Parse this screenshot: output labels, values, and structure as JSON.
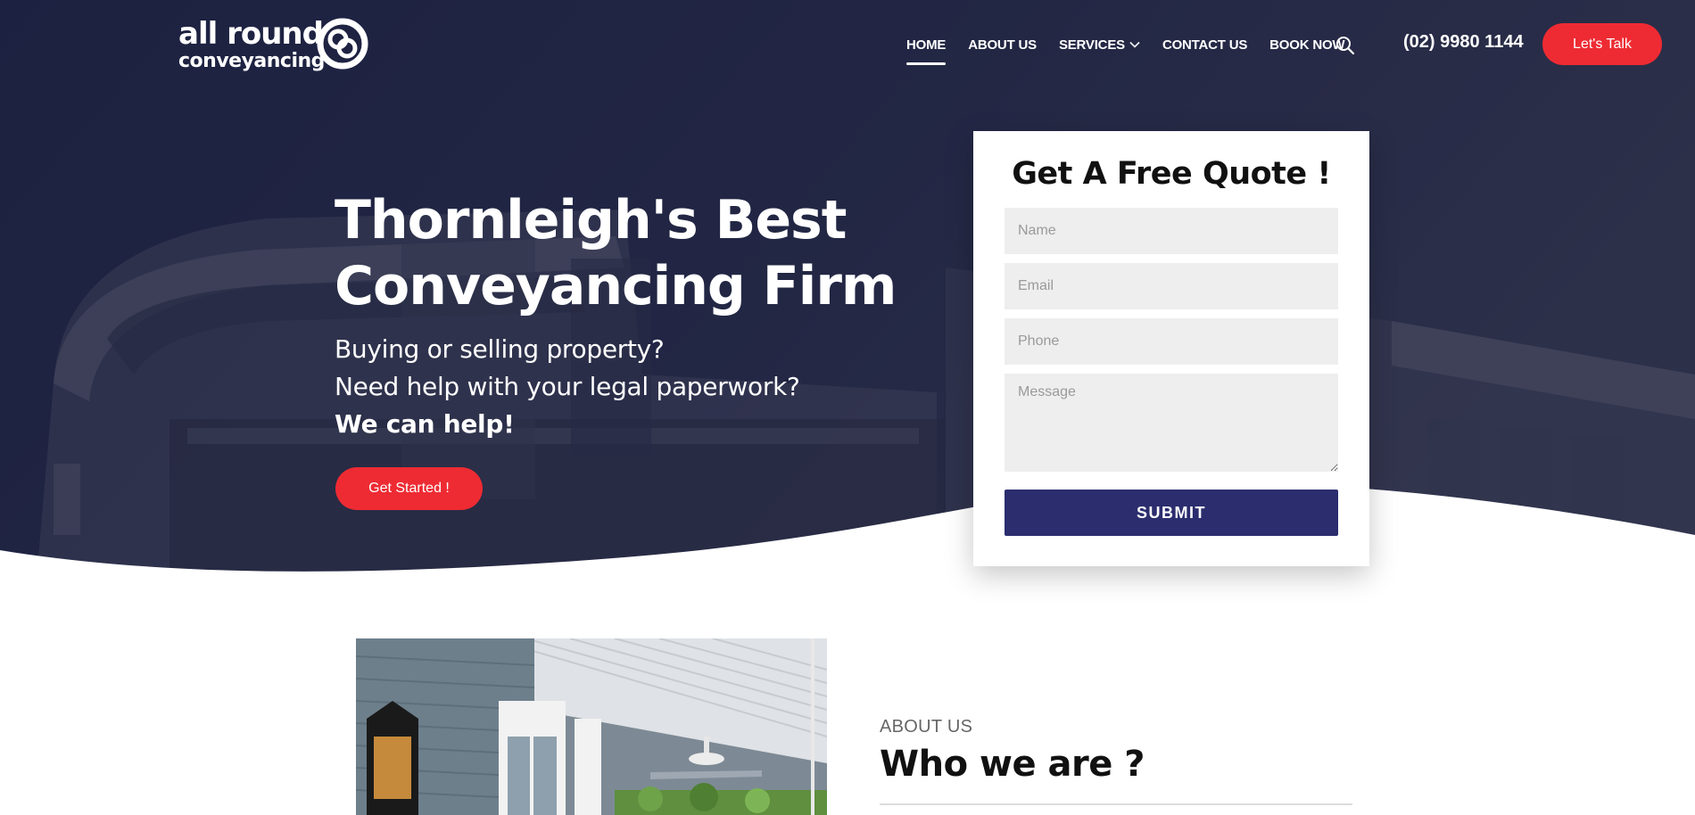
{
  "brand": {
    "logo_line1": "all round",
    "logo_line2": "conveyancing",
    "accent": "#ee2b33",
    "navy": "#2b2d6e"
  },
  "nav": {
    "items": [
      {
        "label": "HOME",
        "active": true
      },
      {
        "label": "ABOUT US"
      },
      {
        "label": "SERVICES",
        "has_dropdown": true
      },
      {
        "label": "CONTACT US"
      },
      {
        "label": "BOOK NOW"
      }
    ],
    "search_icon": "search-icon",
    "phone": "(02) 9980 1144",
    "cta": "Let's Talk"
  },
  "hero": {
    "title": "Thornleigh's Best Conveyancing Firm",
    "sub_line1": "Buying or selling property?",
    "sub_line2": "Need help with your legal paperwork?",
    "sub_line3": "We can help!",
    "button": "Get Started !"
  },
  "quote_form": {
    "title": "Get A Free Quote !",
    "name_placeholder": "Name",
    "email_placeholder": "Email",
    "phone_placeholder": "Phone",
    "message_placeholder": "Message",
    "submit": "SUBMIT"
  },
  "about": {
    "eyebrow": "ABOUT US",
    "title": "Who we are ?"
  }
}
